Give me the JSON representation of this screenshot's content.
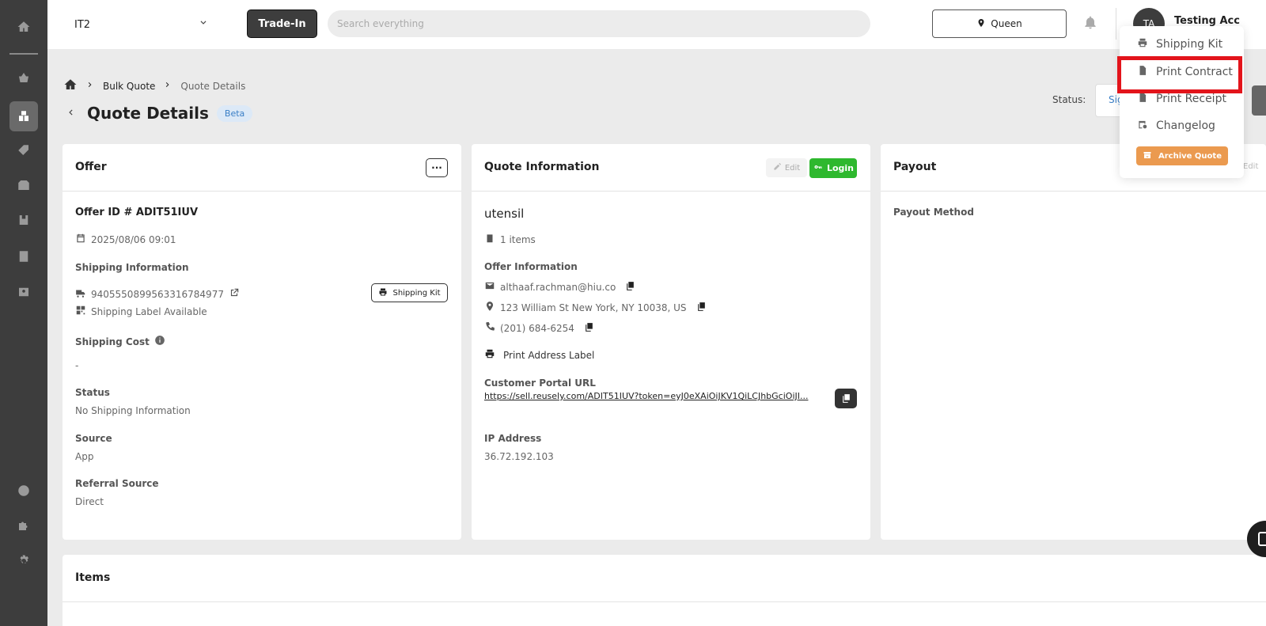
{
  "sidebar": {
    "icons": [
      "home-icon",
      "basket-icon",
      "boxes-icon",
      "tag-icon",
      "package-icon",
      "inventory-icon",
      "document-icon",
      "contacts-icon",
      "help-icon",
      "puzzle-icon",
      "gear-icon"
    ]
  },
  "topbar": {
    "store": "IT2",
    "trade_in_label": "Trade-In",
    "search_placeholder": "Search everything",
    "location": "Queen",
    "avatar_initials": "TA",
    "user_name": "Testing Acc"
  },
  "breadcrumb": {
    "items": [
      "Bulk Quote",
      "Quote Details"
    ]
  },
  "page": {
    "title": "Quote Details",
    "badge": "Beta",
    "status_label": "Status:",
    "status_value": "Sig"
  },
  "offer": {
    "title": "Offer",
    "more_label": "···",
    "offer_id": "Offer ID # ADIT51IUV",
    "date": "2025/08/06 09:01",
    "shipping_info_label": "Shipping Information",
    "tracking_number": "9405550899563316784977",
    "shipping_label_status": "Shipping Label Available",
    "shipping_kit_button": "Shipping Kit",
    "shipping_cost_label": "Shipping Cost",
    "shipping_cost_value": "-",
    "status_label": "Status",
    "status_value": "No Shipping Information",
    "source_label": "Source",
    "source_value": "App",
    "referral_label": "Referral Source",
    "referral_value": "Direct"
  },
  "quote_info": {
    "title": "Quote Information",
    "edit_label": "Edit",
    "login_label": "Login",
    "customer_name": "utensil",
    "items_count": "1 items",
    "offer_info_label": "Offer Information",
    "email": "althaaf.rachman@hiu.co",
    "address": "123 William St New York, NY 10038, US",
    "phone": "(201) 684-6254",
    "print_label": "Print Address Label",
    "portal_label": "Customer Portal URL",
    "portal_url": "https://sell.reusely.com/ADIT51IUV?token=eyJ0eXAiOiJKV1QiLCJhbGciOiJI...",
    "ip_label": "IP Address",
    "ip_value": "36.72.192.103"
  },
  "payout": {
    "title": "Payout",
    "edit_label": "Edit",
    "method_label": "Payout Method"
  },
  "items": {
    "title": "Items"
  },
  "menu": {
    "items": [
      "Shipping Kit",
      "Print Contract",
      "Print Receipt",
      "Changelog"
    ],
    "archive_label": "Archive Quote"
  },
  "colors": {
    "sidebar": "#3d3d3d",
    "login_green": "#2eb82e",
    "archive_orange": "#eb9a4f",
    "highlight_red": "#e3141b",
    "beta_blue": "#3a7fc6"
  }
}
